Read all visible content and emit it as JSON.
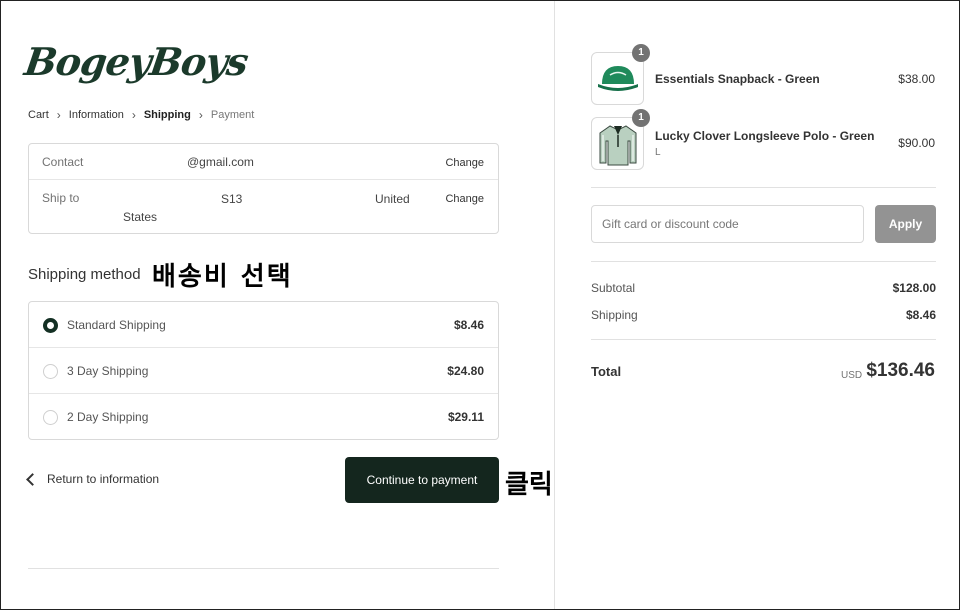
{
  "logo": {
    "text": "BogeyBoys"
  },
  "breadcrumb": {
    "items": [
      "Cart",
      "Information",
      "Shipping",
      "Payment"
    ]
  },
  "review": {
    "contact_label": "Contact",
    "contact_value": "@gmail.com",
    "contact_change": "Change",
    "shipto_label": "Ship to",
    "shipto_part1": "S13",
    "shipto_part2": "United",
    "shipto_part3": "States",
    "shipto_change": "Change"
  },
  "shipping": {
    "title": "Shipping method",
    "methods": [
      {
        "label": "Standard Shipping",
        "price": "$8.46",
        "selected": true
      },
      {
        "label": "3 Day Shipping",
        "price": "$24.80",
        "selected": false
      },
      {
        "label": "2 Day Shipping",
        "price": "$29.11",
        "selected": false
      }
    ]
  },
  "annotations": {
    "select_shipping": "배송비 선택",
    "click": "클릭"
  },
  "nav": {
    "return_label": "Return to information",
    "continue_label": "Continue to payment"
  },
  "cart": {
    "items": [
      {
        "name": "Essentials Snapback - Green",
        "variant": "",
        "price": "$38.00",
        "qty": "1",
        "icon": "cap-icon"
      },
      {
        "name": "Lucky Clover Longsleeve Polo - Green",
        "variant": "L",
        "price": "$90.00",
        "qty": "1",
        "icon": "polo-shirt-icon"
      }
    ],
    "discount_placeholder": "Gift card or discount code",
    "apply_label": "Apply",
    "subtotal_label": "Subtotal",
    "subtotal_value": "$128.00",
    "shipping_label": "Shipping",
    "shipping_value": "$8.46",
    "total_label": "Total",
    "currency": "USD",
    "total_value": "$136.46"
  },
  "colors": {
    "brand_dark": "#14261e",
    "apply_gray": "#939393",
    "badge_gray": "#737373",
    "cap_green": "#1f8a5b"
  }
}
